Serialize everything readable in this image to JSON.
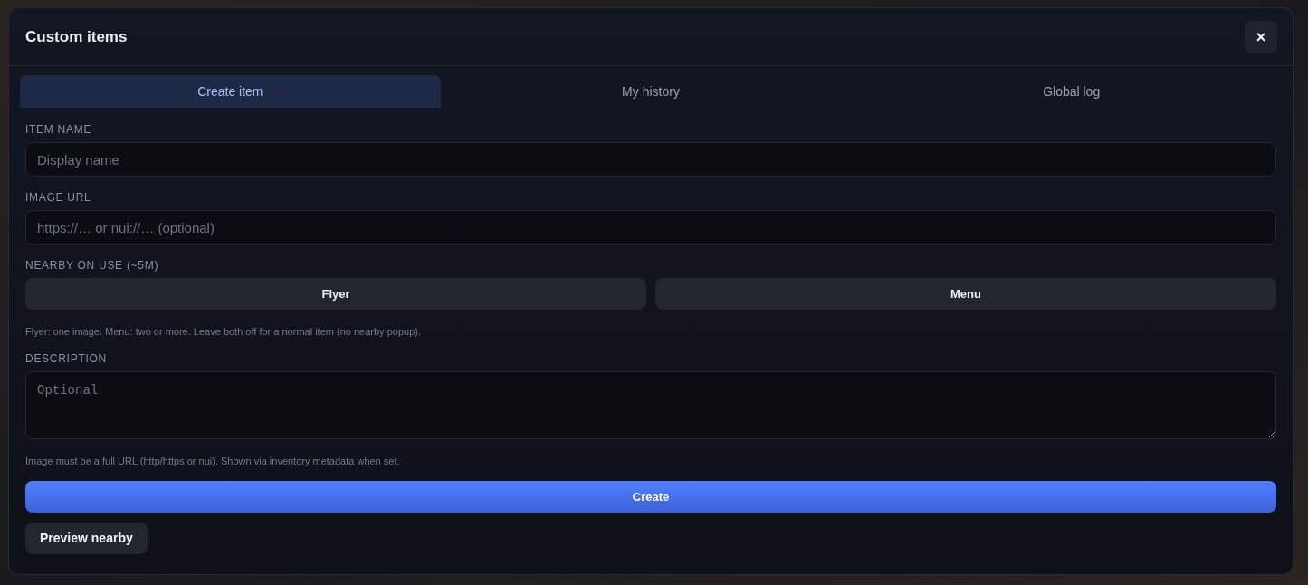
{
  "window": {
    "title": "Custom items",
    "close_label": "×"
  },
  "tabs": [
    {
      "label": "Create item",
      "selected": true
    },
    {
      "label": "My history",
      "selected": false
    },
    {
      "label": "Global log",
      "selected": false
    }
  ],
  "form": {
    "fields": [
      {
        "kind": "input",
        "label": "ITEM NAME",
        "placeholder": "Display name"
      },
      {
        "kind": "input",
        "label": "IMAGE URL",
        "placeholder": "https://… or nui://… (optional)"
      },
      {
        "kind": "toggles",
        "label": "NEARBY ON USE (~5M)",
        "options": [
          {
            "label": "Flyer",
            "on": false
          },
          {
            "label": "Menu",
            "on": false
          }
        ],
        "hint": "Flyer: one image. Menu: two or more. Leave both off for a normal item (no nearby popup)."
      },
      {
        "kind": "textarea",
        "label": "DESCRIPTION",
        "placeholder": "Optional",
        "hint": "Image must be a full URL (http/https or nui). Shown via inventory metadata when set."
      }
    ]
  },
  "buttons": [
    {
      "kind": "primary",
      "label": "Create"
    },
    {
      "kind": "secondary",
      "label": "Preview nearby"
    }
  ]
}
